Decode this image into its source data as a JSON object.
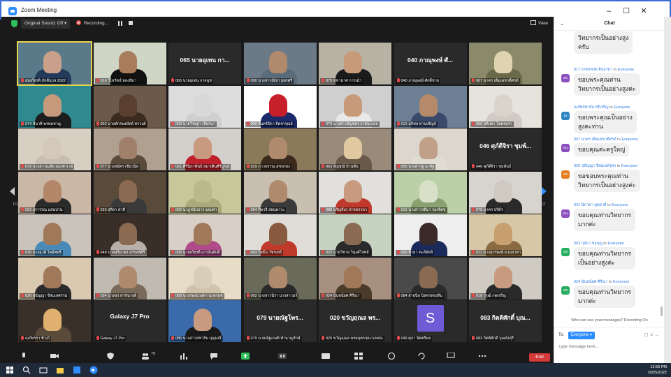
{
  "window": {
    "title": "Zoom Meeting",
    "minimize": "–",
    "maximize": "☐",
    "close": "✕"
  },
  "topbar": {
    "original_sound": "Original Sound: Off ▾",
    "recording": "Recording...",
    "view": "View"
  },
  "pagination": {
    "left": "1/2",
    "right": "1/2"
  },
  "tiles": [
    {
      "name": "สมเกียรติ ภักดีนวล 2022",
      "big": "",
      "bg": "#5a7a8a",
      "face": "#c9a08a",
      "shirt": "#243a5a",
      "active": true
    },
    {
      "name": "016 วิไลรัตน์ ทองลีมา",
      "big": "",
      "bg": "#cfd6c5",
      "face": "#a87d5c",
      "shirt": "#111111"
    },
    {
      "name": "065 นายอุเทน กาจฉุช",
      "big": "065 นายอุเทน กา...",
      "bg": "#2a2a2a"
    },
    {
      "name": "090 นางสาวณิชา บุตรศรี",
      "big": "",
      "bg": "#6b7a86",
      "face": "#b08a6d",
      "shirt": "#5a6b7a"
    },
    {
      "name": "075 จุฑามาศ การเม้า",
      "big": "",
      "bg": "#b8b2a5",
      "face": "#c79a7a",
      "shirt": "#1b1b1b"
    },
    {
      "name": "040 ภาณุพงษ์ ศักดิ์ชาย",
      "big": "040 ภาณุพงษ์ ศั...",
      "bg": "#2a2a2a"
    },
    {
      "name": "007 นาคร เต็มเดชาติ์ศรด์",
      "big": "",
      "bg": "#8a8a6a",
      "face": "#e0d4b0",
      "shirt": "#6a6a4a"
    },
    {
      "name": "074 บีนาพี พรหมชาญ",
      "big": "",
      "bg": "#2e8a8f",
      "face": "#c59a7c",
      "shirt": "#1d1d1d"
    },
    {
      "name": "002 นายพักรพงษ์ทธ์ ทรวงต์",
      "big": "",
      "bg": "#6b5a4a",
      "face": "#5a3e2e",
      "shirt": "#3a2a1e"
    },
    {
      "name": "003 นายวีรุทฐา เจียกนา",
      "big": "",
      "bg": "#dcdcdc",
      "face": "#d8d8d8",
      "shirt": "#cfcfcf"
    },
    {
      "name": "009 จันทร์ธิดา จิตรกรุณย์",
      "big": "",
      "bg": "#ffffff",
      "face": "#c8202a",
      "shirt": "#1a2a6a"
    },
    {
      "name": "076 นางสาวอัญชยร กาสนาเปล",
      "big": "",
      "bg": "#cfcfcf",
      "face": "#c79a7a",
      "shirt": "#e8e8e8"
    },
    {
      "name": "012 อภิชล ทานเช็ญจ์",
      "big": "",
      "bg": "#6d7f95",
      "face": "#b48a6a",
      "shirt": "#3a4a6a"
    },
    {
      "name": "066 อดีปยา โตตรพรา",
      "big": "",
      "bg": "#e6e2dc",
      "face": "#d8d4cc",
      "shirt": "#d0cbc4"
    },
    {
      "name": "072 นางสาวเมลัย มณฑาเวช",
      "big": "",
      "bg": "#d8cfc3",
      "face": "#d3c8bb",
      "shirt": "#c7bdb0"
    },
    {
      "name": "077 นางสมัคร เขียวนิล",
      "big": "",
      "bg": "#b0a090",
      "face": "#a0806a",
      "shirt": "#5a4a3a"
    },
    {
      "name": "021 ศิรินิภาพันธ์ สมาเศินศิรีบูรณ์",
      "big": "",
      "bg": "#d3cfca",
      "face": "#c89a80",
      "shirt": "#c0202a"
    },
    {
      "name": "029 ภาวพรรณ สุขพรอง",
      "big": "",
      "bg": "#8a7a5a",
      "face": "#b08a6d",
      "shirt": "#3a2a1e"
    },
    {
      "name": "063 อัญชุณี บำนทับ",
      "big": "",
      "bg": "#9a8a7a",
      "face": "#e0c8a0",
      "shirt": "#6a5a4a"
    },
    {
      "name": "050 นางสาวฐ นาทัฐ",
      "big": "",
      "bg": "#dcd6cc",
      "face": "#c0a088",
      "shirt": "#e0dcd4"
    },
    {
      "name": "046 ศุภ์ดีจิรา ชุมพันธ์",
      "big": "046 ศุภ์ดีจิรา ชุมพ์...",
      "bg": "#2a2a2a"
    },
    {
      "name": "023 ยุรารรณ แสนปาน",
      "big": "",
      "bg": "#c9b8a6",
      "face": "#b5876a",
      "shirt": "#2a2a2a"
    },
    {
      "name": "033 สุลีลา ค่าสี",
      "big": "",
      "bg": "#5a4a3a",
      "face": "#8a6a50",
      "shirt": "#3a3a3a"
    },
    {
      "name": "092 นาฏชนิกธาร มณฑา",
      "big": "",
      "bg": "#c6c79a",
      "face": "#b9ba8c",
      "shirt": "#a9aa7c"
    },
    {
      "name": "094 ทิพวรี สอนพาวะ",
      "big": "",
      "bg": "#c9bfb0",
      "face": "#b08a6d",
      "shirt": "#3a3a3a"
    },
    {
      "name": "088 นรีญถึงกุ ช่ารตรวดา",
      "big": "",
      "bg": "#e2e0dc",
      "face": "#c89a80",
      "shirt": "#c0392b"
    },
    {
      "name": "019 นางสาวรติมา รองจิตชุ",
      "big": "",
      "bg": "#bcd0a8",
      "face": "#d8e0c8",
      "shirt": "#8aa070"
    },
    {
      "name": "078 นาคร ปรีด์ร",
      "big": "",
      "bg": "#d7d3ce",
      "face": "#cfc9c2",
      "shirt": "#2a2a2a"
    },
    {
      "name": "025 นางยุวดี โพธิศพรี",
      "big": "",
      "bg": "#c9c3bc",
      "face": "#a0785a",
      "shirt": "#4a8ab8"
    },
    {
      "name": "048 นายสุริยาพร อรรถพ์ศิริ",
      "big": "",
      "bg": "#3a2e28",
      "face": "#8a6a50",
      "shirt": "#b8b0a8"
    },
    {
      "name": "005 นายเกียรติ์ เภาบันศักดิ์",
      "big": "",
      "bg": "#d8d0c6",
      "face": "#a0785a",
      "shirt": "#b04a8a"
    },
    {
      "name": "043 โพธิ์น วัชรเทย์",
      "big": "",
      "bg": "#e0ddd8",
      "face": "#8a5a40",
      "shirt": "#c0392b"
    },
    {
      "name": "022 นายวิชาล วินุงศ์โจทย์",
      "big": "",
      "bg": "#c6d3c0",
      "face": "#8a6a50",
      "shirt": "#2a2a2a"
    },
    {
      "name": "030 พี่วมา ทะลิจัตสิ",
      "big": "",
      "bg": "#eeeeee",
      "face": "#3a2a2a",
      "shirt": "#1a2a5a"
    },
    {
      "name": "011 นางสุวรพงษ์ มวมยาตา",
      "big": "",
      "bg": "#d6c7a6",
      "face": "#c8a070",
      "shirt": "#8a6a40"
    },
    {
      "name": "026 สุนัญญา จีสมเลศรรม",
      "big": "",
      "bg": "#d9c9b0",
      "face": "#a0785a",
      "shirt": "#2a2a2a"
    },
    {
      "name": "034 นางพร สาชนางพ์",
      "big": "",
      "bg": "#c0bab0",
      "face": "#b08a6d",
      "shirt": "#7a6a5a"
    },
    {
      "name": "068 นางรพงฉวงดา นะพรฮุช",
      "big": "",
      "bg": "#e6dcc8",
      "face": "#d8cdb8",
      "shirt": "#cfc3ad"
    },
    {
      "name": "062 นางสาวนิรา นางสาวมร์",
      "big": "",
      "bg": "#6a6a5a",
      "face": "#b08a6d",
      "shirt": "#2a2a2a"
    },
    {
      "name": "024 นันทน์ยศ ศิรีณา",
      "big": "",
      "bg": "#a89080",
      "face": "#a0785a",
      "shirt": "#4a3a2a"
    },
    {
      "name": "084 สายนิล นิลพรทองทิม",
      "big": "",
      "bg": "#4a4a4a",
      "face": "#8a6a50",
      "shirt": "#2a2a2a"
    },
    {
      "name": "018 วรุฒิ กตเจริญ",
      "big": "",
      "bg": "#cfcac2",
      "face": "#c89a80",
      "shirt": "#2a2a2a"
    },
    {
      "name": "ณภัทรรา ช้างโ",
      "big": "",
      "bg": "#3a302a",
      "face": "#e0b070",
      "shirt": "#5a4a3a"
    },
    {
      "name": "Galaxy J7 Pro",
      "big": "Galaxy J7 Pro",
      "bg": "#2a2a2a"
    },
    {
      "name": "085 นางสาวสชาลิน บุญมณี",
      "big": "",
      "bg": "#3a6aaa",
      "face": "#c89a80",
      "shirt": "#1a1a1a"
    },
    {
      "name": "079 นายณัฐเกษติ ทำนาญรักษ์",
      "big": "079 นายณัฐโพร...",
      "bg": "#2a2a2a"
    },
    {
      "name": "020 ขวัญฤณล พรมบุตร/อนาเลยปะ",
      "big": "020 ขวัญฤณล พร...",
      "bg": "#2a2a2a"
    },
    {
      "name": "049 ศุภา จิตตรีพล",
      "big": "",
      "bg": "#2a2a2a",
      "letter": "S"
    },
    {
      "name": "083 กิตติศักดิ์ บุณยังสุรี",
      "big": "083 กิตติศักดิ์ บุณ...",
      "bg": "#2a2a2a"
    }
  ],
  "toolbar": {
    "participants_count": "79",
    "end": "End"
  },
  "chat": {
    "title": "Chat",
    "to_label": "To:",
    "to_value": "Everyone ▾",
    "placeholder": "Type message here...",
    "notice": "Who can see your messages? Recording On",
    "messages": [
      {
        "sender": "",
        "to": "",
        "avatar": "",
        "color": "#8b4fbf",
        "text": "วิทยากรเป็นอย่างสูง\nครับ"
      },
      {
        "sender": "017 ธรพรพรต อินธรมา",
        "to": "Everyone",
        "avatar": "อธ",
        "color": "#8b4fbf",
        "text": "ขอบพระคุณท่าน\nวิทยากรเป็นอย่างสูงค่ะ"
      },
      {
        "sender": "ณภัทรชายัล ทรีเจริญ",
        "to": "Everyone",
        "avatar": "ณ",
        "color": "#2e86c1",
        "text": "ขอบพระคุณเป็นอย่าง\nสูงคะท่าน"
      },
      {
        "sender": "007 นาคร เต็มเดชาติ์ศรด์",
        "to": "Everyone",
        "avatar": "อน",
        "color": "#8b4fbf",
        "text": "ขอบคุณค่ะครูใหญ่"
      },
      {
        "sender": "026 สุขัญญา จีสมเลศรุตร",
        "to": "Everyone",
        "avatar": "สจ",
        "color": "#e67e22",
        "text": "ขอขอบพระคุณท่าน\nวิทยากรเป็นอย่างสูงค่ะ"
      },
      {
        "sender": "041 นิภาดา มุทยาดี",
        "to": "Everyone",
        "avatar": "อน",
        "color": "#8b4fbf",
        "text": "ขอบคุณท่านวิทยากร\nมากค่ะ"
      },
      {
        "sender": "003 กุสมา ขอบุญ",
        "to": "Everyone",
        "avatar": "อท",
        "color": "#27ae60",
        "text": "ขอบคุณท่านวิทยากร\nเป็นอย่างสูงค่ะ"
      },
      {
        "sender": "024 นันทน์ยศ ศิรีณา",
        "to": "Everyone",
        "avatar": "อท",
        "color": "#27ae60",
        "text": "ขอบคุณท่านวิทยากร\nมากค่ะ"
      }
    ]
  },
  "taskbar": {
    "time": "12:56 PM",
    "date": "10/25/2022"
  }
}
